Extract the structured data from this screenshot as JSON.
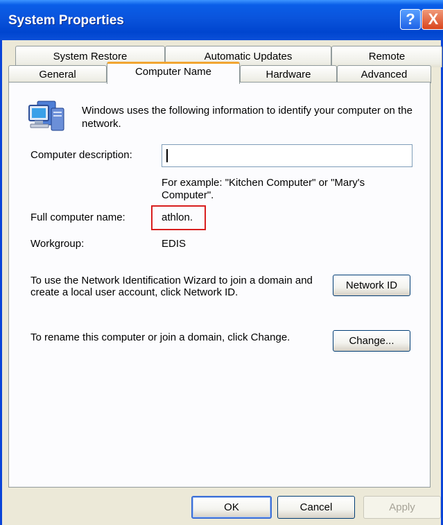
{
  "window": {
    "title": "System Properties",
    "help_symbol": "?",
    "close_symbol": "X"
  },
  "tabs": {
    "row1": [
      "System Restore",
      "Automatic Updates",
      "Remote"
    ],
    "row2": [
      "General",
      "Computer Name",
      "Hardware",
      "Advanced"
    ],
    "active": "Computer Name"
  },
  "computer_name": {
    "intro": "Windows uses the following information to identify your computer on the network.",
    "description_label": "Computer description:",
    "description_value": "",
    "example_text": "For example: \"Kitchen Computer\" or \"Mary's Computer\".",
    "full_name_label": "Full computer name:",
    "full_name_value": "athlon.",
    "workgroup_label": "Workgroup:",
    "workgroup_value": "EDIS",
    "network_id_text": "To use the Network Identification Wizard to join a domain and create a local user account, click Network ID.",
    "network_id_button": "Network ID",
    "rename_text": "To rename this computer or join a domain, click Change.",
    "change_button": "Change..."
  },
  "footer": {
    "ok": "OK",
    "cancel": "Cancel",
    "apply": "Apply"
  },
  "colors": {
    "title_bar": "#0a54dc",
    "dialog_bg": "#ece9d8",
    "highlight": "#d81e1e",
    "active_tab_accent": "#f1a531"
  }
}
